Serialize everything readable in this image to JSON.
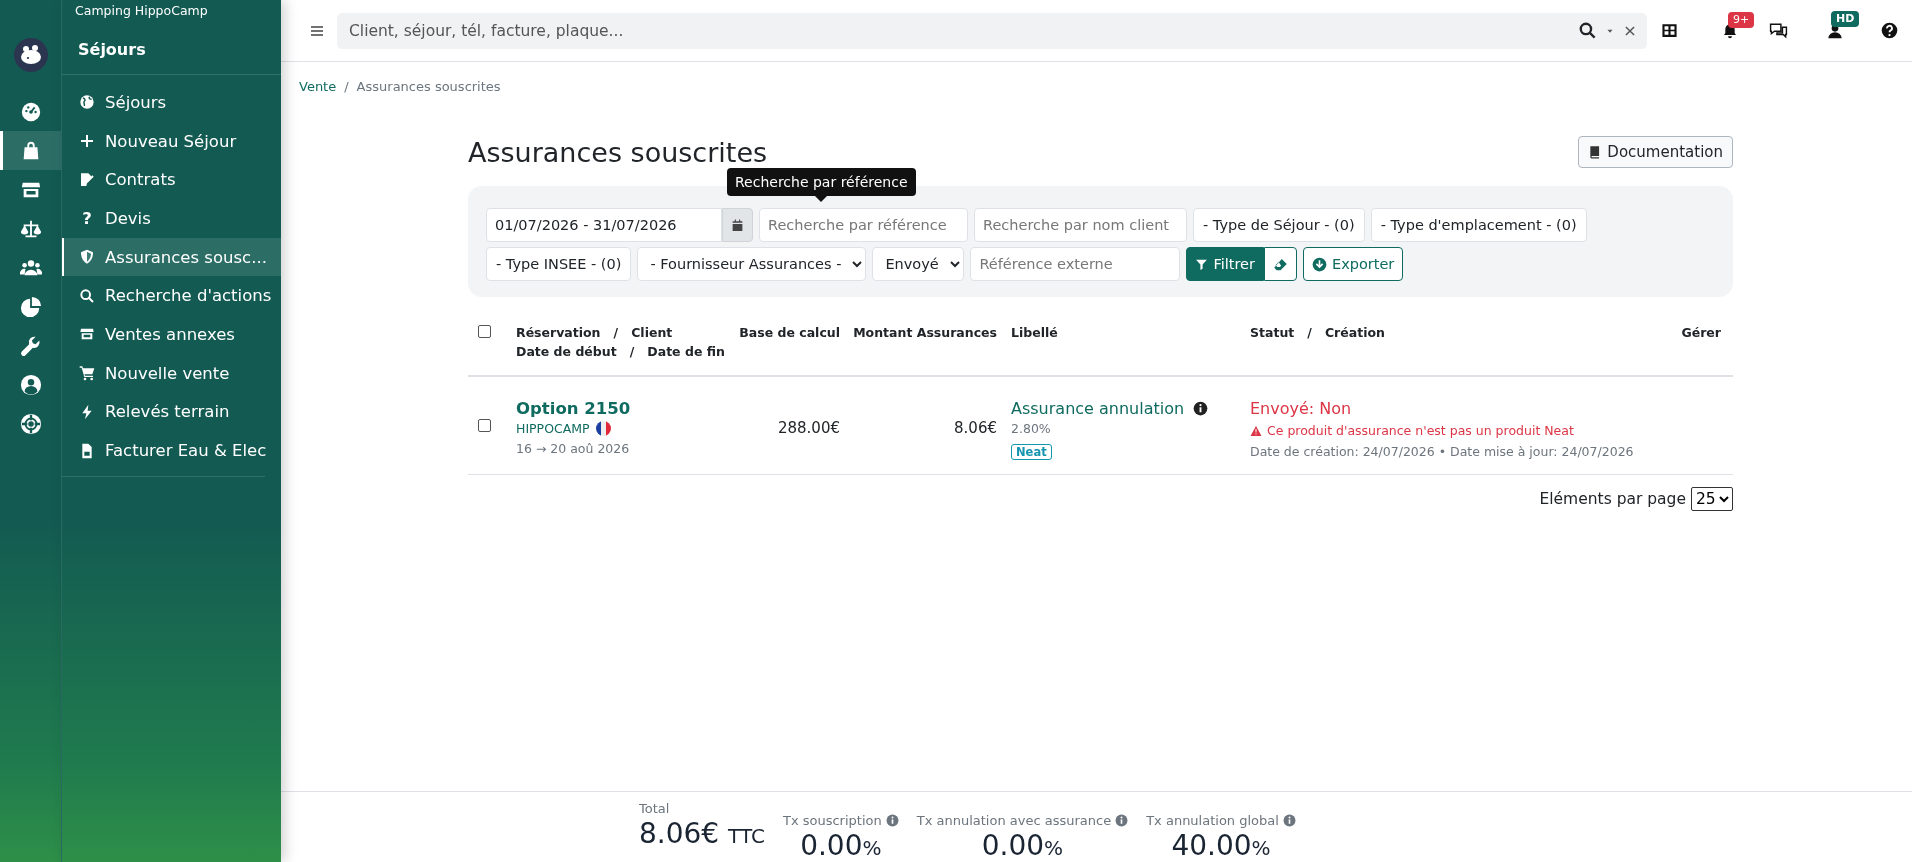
{
  "sidebar": {
    "camping_name": "Camping HippoCamp",
    "section_title": "Séjours",
    "rail_items": [
      {
        "selected": false
      },
      {
        "selected": true
      },
      {
        "selected": false
      },
      {
        "selected": false
      },
      {
        "selected": false
      },
      {
        "selected": false
      },
      {
        "selected": false
      },
      {
        "selected": false
      },
      {
        "selected": false
      }
    ],
    "items": [
      {
        "label": "Séjours",
        "selected": false
      },
      {
        "label": "Nouveau Séjour",
        "selected": false
      },
      {
        "label": "Contrats",
        "selected": false
      },
      {
        "label": "Devis",
        "selected": false,
        "glyph": "?"
      },
      {
        "label": "Assurances sousc...",
        "selected": true
      },
      {
        "label": "Recherche d'actions",
        "selected": false
      },
      {
        "label": "Ventes annexes",
        "selected": false
      },
      {
        "label": "Nouvelle vente",
        "selected": false
      },
      {
        "label": "Relevés terrain",
        "selected": false
      },
      {
        "label": "Facturer Eau & Elec",
        "selected": false
      }
    ]
  },
  "topbar": {
    "search": {
      "placeholder": "Client, séjour, tél, facture, plaque..."
    },
    "notification_badge": "9+",
    "user_initials": "HD"
  },
  "breadcrumb": {
    "items": [
      "Vente",
      "Assurances souscrites"
    ],
    "separator": "/"
  },
  "page_title": "Assurances souscrites",
  "documentation_button": "Documentation",
  "tooltip": "Recherche par référence",
  "filters": [
    {
      "kind": "date",
      "value": "01/07/2026 - 31/07/2026"
    },
    {
      "kind": "input",
      "placeholder": "Recherche par référence"
    },
    {
      "kind": "input",
      "placeholder": "Recherche par nom client"
    },
    {
      "kind": "multiselect",
      "label": "- Type de Séjour - (0)"
    },
    {
      "kind": "multiselect",
      "label": "- Type d'emplacement - (0)"
    },
    {
      "kind": "multiselect",
      "label": "- Type INSEE - (0)"
    },
    {
      "kind": "select",
      "value": "- Fournisseur Assurances -"
    },
    {
      "kind": "select",
      "value": "Envoyé"
    },
    {
      "kind": "input",
      "placeholder": "Référence externe"
    }
  ],
  "filter_button": "Filtrer",
  "export_button": "Exporter",
  "table": {
    "select_all_checked": false,
    "columns": [
      {
        "lines": [
          "Réservation   /   Client",
          "Date de début   /   Date de fin"
        ]
      },
      {
        "lines": [
          "Base de calcul"
        ]
      },
      {
        "lines": [
          "Montant Assurances"
        ]
      },
      {
        "lines": [
          "Libellé"
        ]
      },
      {
        "lines": [
          "Statut   /   Création"
        ]
      },
      {
        "lines": [
          "Gérer"
        ]
      }
    ],
    "rows": [
      {
        "checked": false,
        "reservation": "Option 2150",
        "client": "HIPPOCAMP",
        "dates": "16 → 20 aoû 2026",
        "base": "288.00€",
        "amount": "8.06€",
        "label": "Assurance annulation",
        "rate": "2.80%",
        "tag": "Neat",
        "status": "Envoyé: Non",
        "warning": "Ce produit d'assurance n'est pas un produit Neat",
        "dates_info": "Date de création: 24/07/2026 • Date mise à jour: 24/07/2026"
      }
    ]
  },
  "pager": {
    "label": "Eléments par page",
    "value": "25"
  },
  "footer_stats": [
    {
      "label": "Total",
      "value": "8.06€",
      "unit": "TTC",
      "info": false
    },
    {
      "label": "Tx souscription",
      "value": "0.00",
      "unit": "%",
      "info": true
    },
    {
      "label": "Tx annulation avec assurance",
      "value": "0.00",
      "unit": "%",
      "info": true
    },
    {
      "label": "Tx annulation global",
      "value": "40.00",
      "unit": "%",
      "info": true
    }
  ]
}
